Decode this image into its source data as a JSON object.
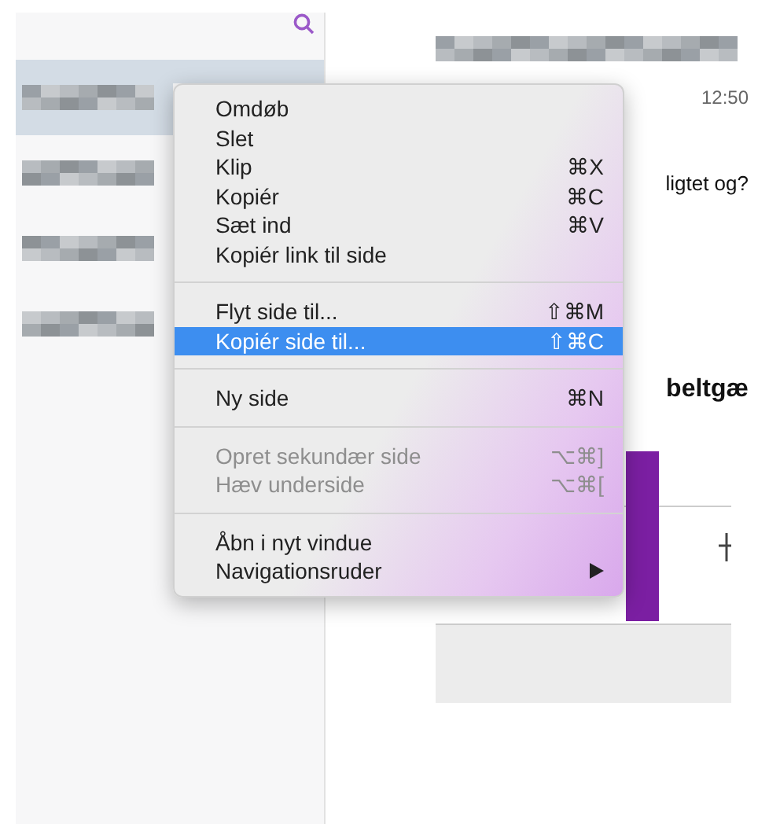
{
  "sidebar": {
    "rows": [
      {
        "selected": true
      },
      {
        "selected": false
      },
      {
        "selected": false
      },
      {
        "selected": false
      }
    ]
  },
  "page": {
    "time": "12:50",
    "text_1": "ligtet og?",
    "heading": "beltgæ"
  },
  "context_menu": {
    "items": [
      {
        "kind": "item",
        "label": "Omdøb",
        "selected": false,
        "disabled": false
      },
      {
        "kind": "item",
        "label": "Slet",
        "selected": false,
        "disabled": false
      },
      {
        "kind": "item",
        "label": "Klip",
        "shortcut": "⌘X",
        "selected": false,
        "disabled": false
      },
      {
        "kind": "item",
        "label": "Kopiér",
        "shortcut": "⌘C",
        "selected": false,
        "disabled": false
      },
      {
        "kind": "item",
        "label": "Sæt ind",
        "shortcut": "⌘V",
        "selected": false,
        "disabled": false
      },
      {
        "kind": "item",
        "label": "Kopiér link til side",
        "selected": false,
        "disabled": false
      },
      {
        "kind": "separator"
      },
      {
        "kind": "item",
        "label": "Flyt side til...",
        "shortcut": "⇧⌘M",
        "selected": false,
        "disabled": false
      },
      {
        "kind": "item",
        "label": "Kopiér side til...",
        "shortcut": "⇧⌘C",
        "selected": true,
        "disabled": false
      },
      {
        "kind": "separator"
      },
      {
        "kind": "item",
        "label": "Ny side",
        "shortcut": "⌘N",
        "selected": false,
        "disabled": false
      },
      {
        "kind": "separator"
      },
      {
        "kind": "item",
        "label": "Opret sekundær side",
        "shortcut": "⌥⌘]",
        "selected": false,
        "disabled": true
      },
      {
        "kind": "item",
        "label": "Hæv underside",
        "shortcut": "⌥⌘[",
        "selected": false,
        "disabled": true
      },
      {
        "kind": "separator"
      },
      {
        "kind": "item",
        "label": "Åbn i nyt vindue",
        "selected": false,
        "disabled": false
      },
      {
        "kind": "submenu",
        "label": "Navigationsruder",
        "selected": false,
        "disabled": false
      }
    ]
  }
}
